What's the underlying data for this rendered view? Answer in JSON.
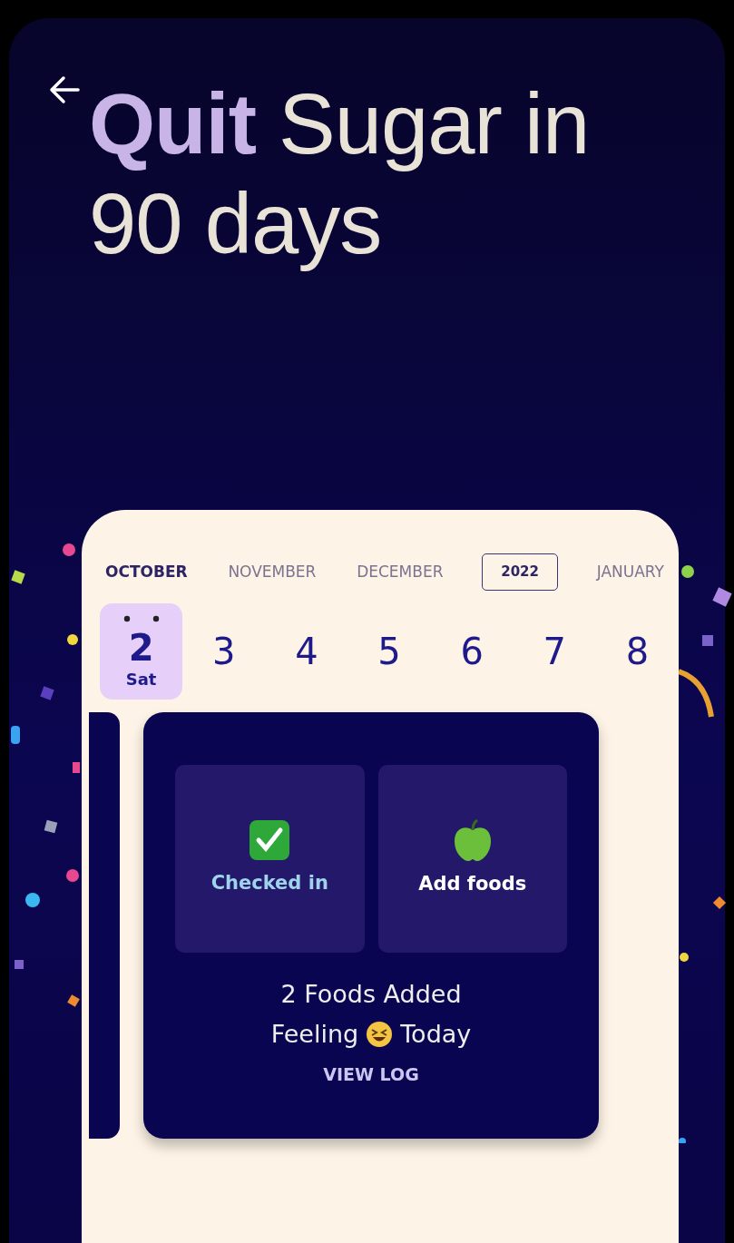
{
  "header": {
    "title": "**Quit** Sugar in 90 days"
  },
  "calendar": {
    "periods": [
      {
        "label": "OCTOBER",
        "kind": "month",
        "selected": true
      },
      {
        "label": "NOVEMBER",
        "kind": "month",
        "selected": false
      },
      {
        "label": "DECEMBER",
        "kind": "month",
        "selected": false
      },
      {
        "label": "2022",
        "kind": "year",
        "selected": false
      },
      {
        "label": "JANUARY",
        "kind": "month",
        "selected": false
      }
    ],
    "days": [
      {
        "day": "2",
        "weekday": "Sat",
        "selected": true
      },
      {
        "day": "3",
        "selected": false
      },
      {
        "day": "4",
        "selected": false
      },
      {
        "day": "5",
        "selected": false
      },
      {
        "day": "6",
        "selected": false
      },
      {
        "day": "7",
        "selected": false
      },
      {
        "day": "8",
        "selected": false
      }
    ]
  },
  "day_card": {
    "actions": [
      {
        "label": "Checked in",
        "kind": "check",
        "checked": true
      },
      {
        "label": "Add foods",
        "kind": "apple"
      }
    ],
    "foods_added": "2 Foods Added",
    "feeling_label": "Feeling",
    "feeling_suffix": "Today",
    "view_log": "VIEW LOG"
  }
}
